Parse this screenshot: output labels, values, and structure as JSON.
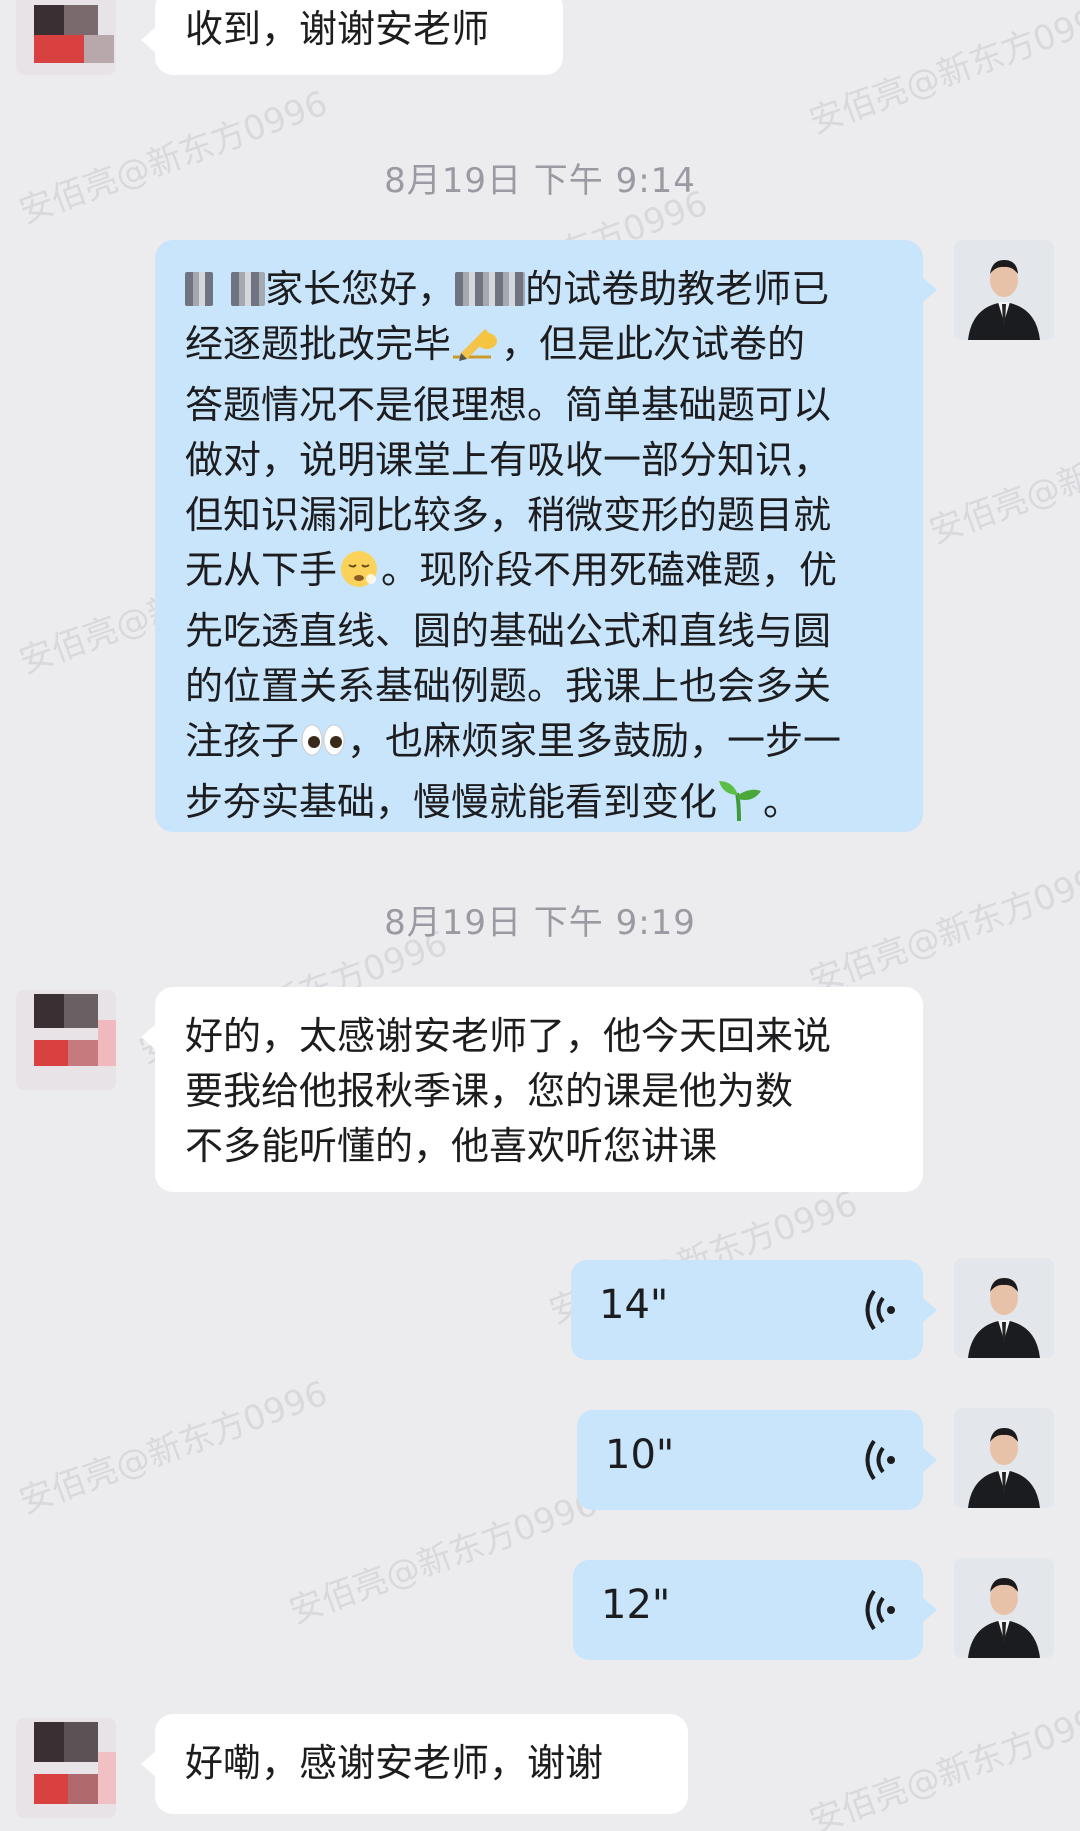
{
  "watermark_text": "安佰亮@新东方0996",
  "messages": {
    "m1": {
      "text": "收到，谢谢安老师"
    },
    "ts1": "8月19日  下午 9:14",
    "m2": {
      "line1_a": "家长您好，",
      "line1_b": "的试卷助教老师已",
      "line2_a": "经逐题批改完毕",
      "line2_b": "，但是此次试卷的",
      "line3": "答题情况不是很理想。简单基础题可以",
      "line4": "做对，说明课堂上有吸收一部分知识，",
      "line5": "但知识漏洞比较多，稍微变形的题目就",
      "line6_a": "无从下手",
      "line6_b": "。现阶段不用死磕难题，优",
      "line7": "先吃透直线、圆的基础公式和直线与圆",
      "line8": "的位置关系基础例题。我课上也会多关",
      "line9_a": "注孩子",
      "line9_b": "，也麻烦家里多鼓励，一步一",
      "line10_a": "步夯实基础，慢慢就能看到变化",
      "line10_b": "。",
      "emoji_write": "writing-hand-emoji",
      "emoji_face": "pensive-face-emoji",
      "emoji_eyes": "eyes-emoji",
      "emoji_sprout": "seedling-emoji"
    },
    "ts2": "8月19日  下午 9:19",
    "m3": {
      "line1": "好的，太感谢安老师了，他今天回来说",
      "line2": "要我给他报秋季课，您的课是他为数",
      "line3": "不多能听懂的，他喜欢听您讲课"
    },
    "voice": [
      {
        "duration": "14\""
      },
      {
        "duration": "10\""
      },
      {
        "duration": "12\""
      }
    ],
    "m4": {
      "text": "好嘞，感谢安老师，谢谢"
    }
  },
  "colors": {
    "background": "#ececef",
    "bubble_left": "#ffffff",
    "bubble_right": "#c9e5fb",
    "timestamp": "#9a9aa2"
  },
  "icons": {
    "voice": "voice-wave-icon",
    "parent_avatar": "blurred-parent-avatar",
    "teacher_avatar": "teacher-avatar"
  }
}
